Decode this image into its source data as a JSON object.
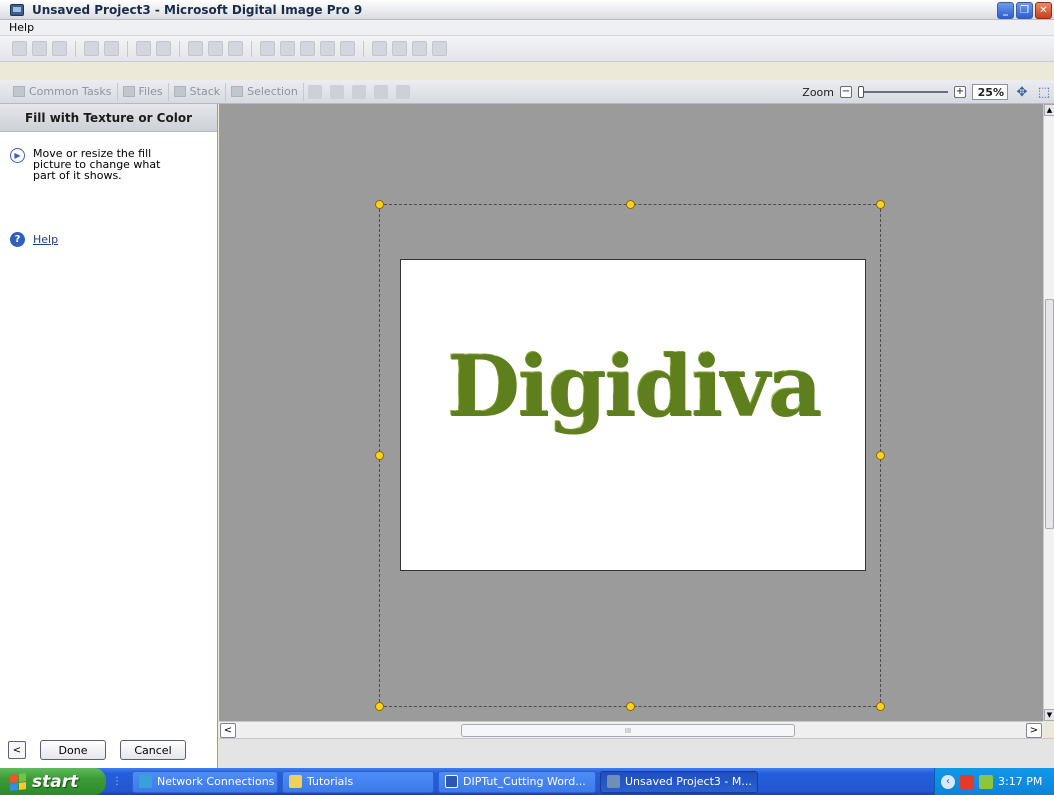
{
  "window": {
    "title": "Unsaved Project3 - Microsoft Digital Image Pro 9"
  },
  "menu": {
    "items": [
      "Help"
    ]
  },
  "toolbar": {
    "icons": [
      "new-icon",
      "open-icon",
      "save-icon",
      "print-icon",
      "print-preview-icon",
      "undo-icon",
      "redo-icon",
      "cut-icon",
      "copy-icon",
      "paste-icon",
      "flip-horizontal-icon",
      "flip-vertical-icon",
      "rotate-left-icon",
      "rotate-right-icon",
      "crop-icon",
      "auto-fix-icon",
      "levels-icon",
      "effects-icon",
      "brush-icon"
    ]
  },
  "command_bar": {
    "common_tasks": "Common Tasks",
    "files": "Files",
    "stack": "Stack",
    "selection": "Selection",
    "zoom_label": "Zoom",
    "zoom_value": "25%",
    "zoom_level": 0.0
  },
  "task_pane": {
    "title": "Fill with Texture or Color",
    "instruction": "Move or resize the fill picture to change what part of it shows.",
    "help_label": "Help",
    "done_label": "Done",
    "cancel_label": "Cancel",
    "back_label": "<"
  },
  "canvas": {
    "text": "Digidiva",
    "text_color": "#7fa332",
    "background": "#9b9b9b"
  },
  "scrollbars": {
    "left_arrow": "<",
    "right_arrow": ">",
    "grip": "III"
  },
  "taskbar": {
    "start_label": "start",
    "tasks": [
      {
        "label": "Network Connections",
        "icon": "network-icon"
      },
      {
        "label": "Tutorials",
        "icon": "folder-icon"
      },
      {
        "label": "DIPTut_Cutting Word...",
        "icon": "word-document-icon"
      },
      {
        "label": "Unsaved Project3 - M...",
        "icon": "digital-image-pro-icon",
        "active": true
      }
    ],
    "clock": "3:17 PM"
  }
}
